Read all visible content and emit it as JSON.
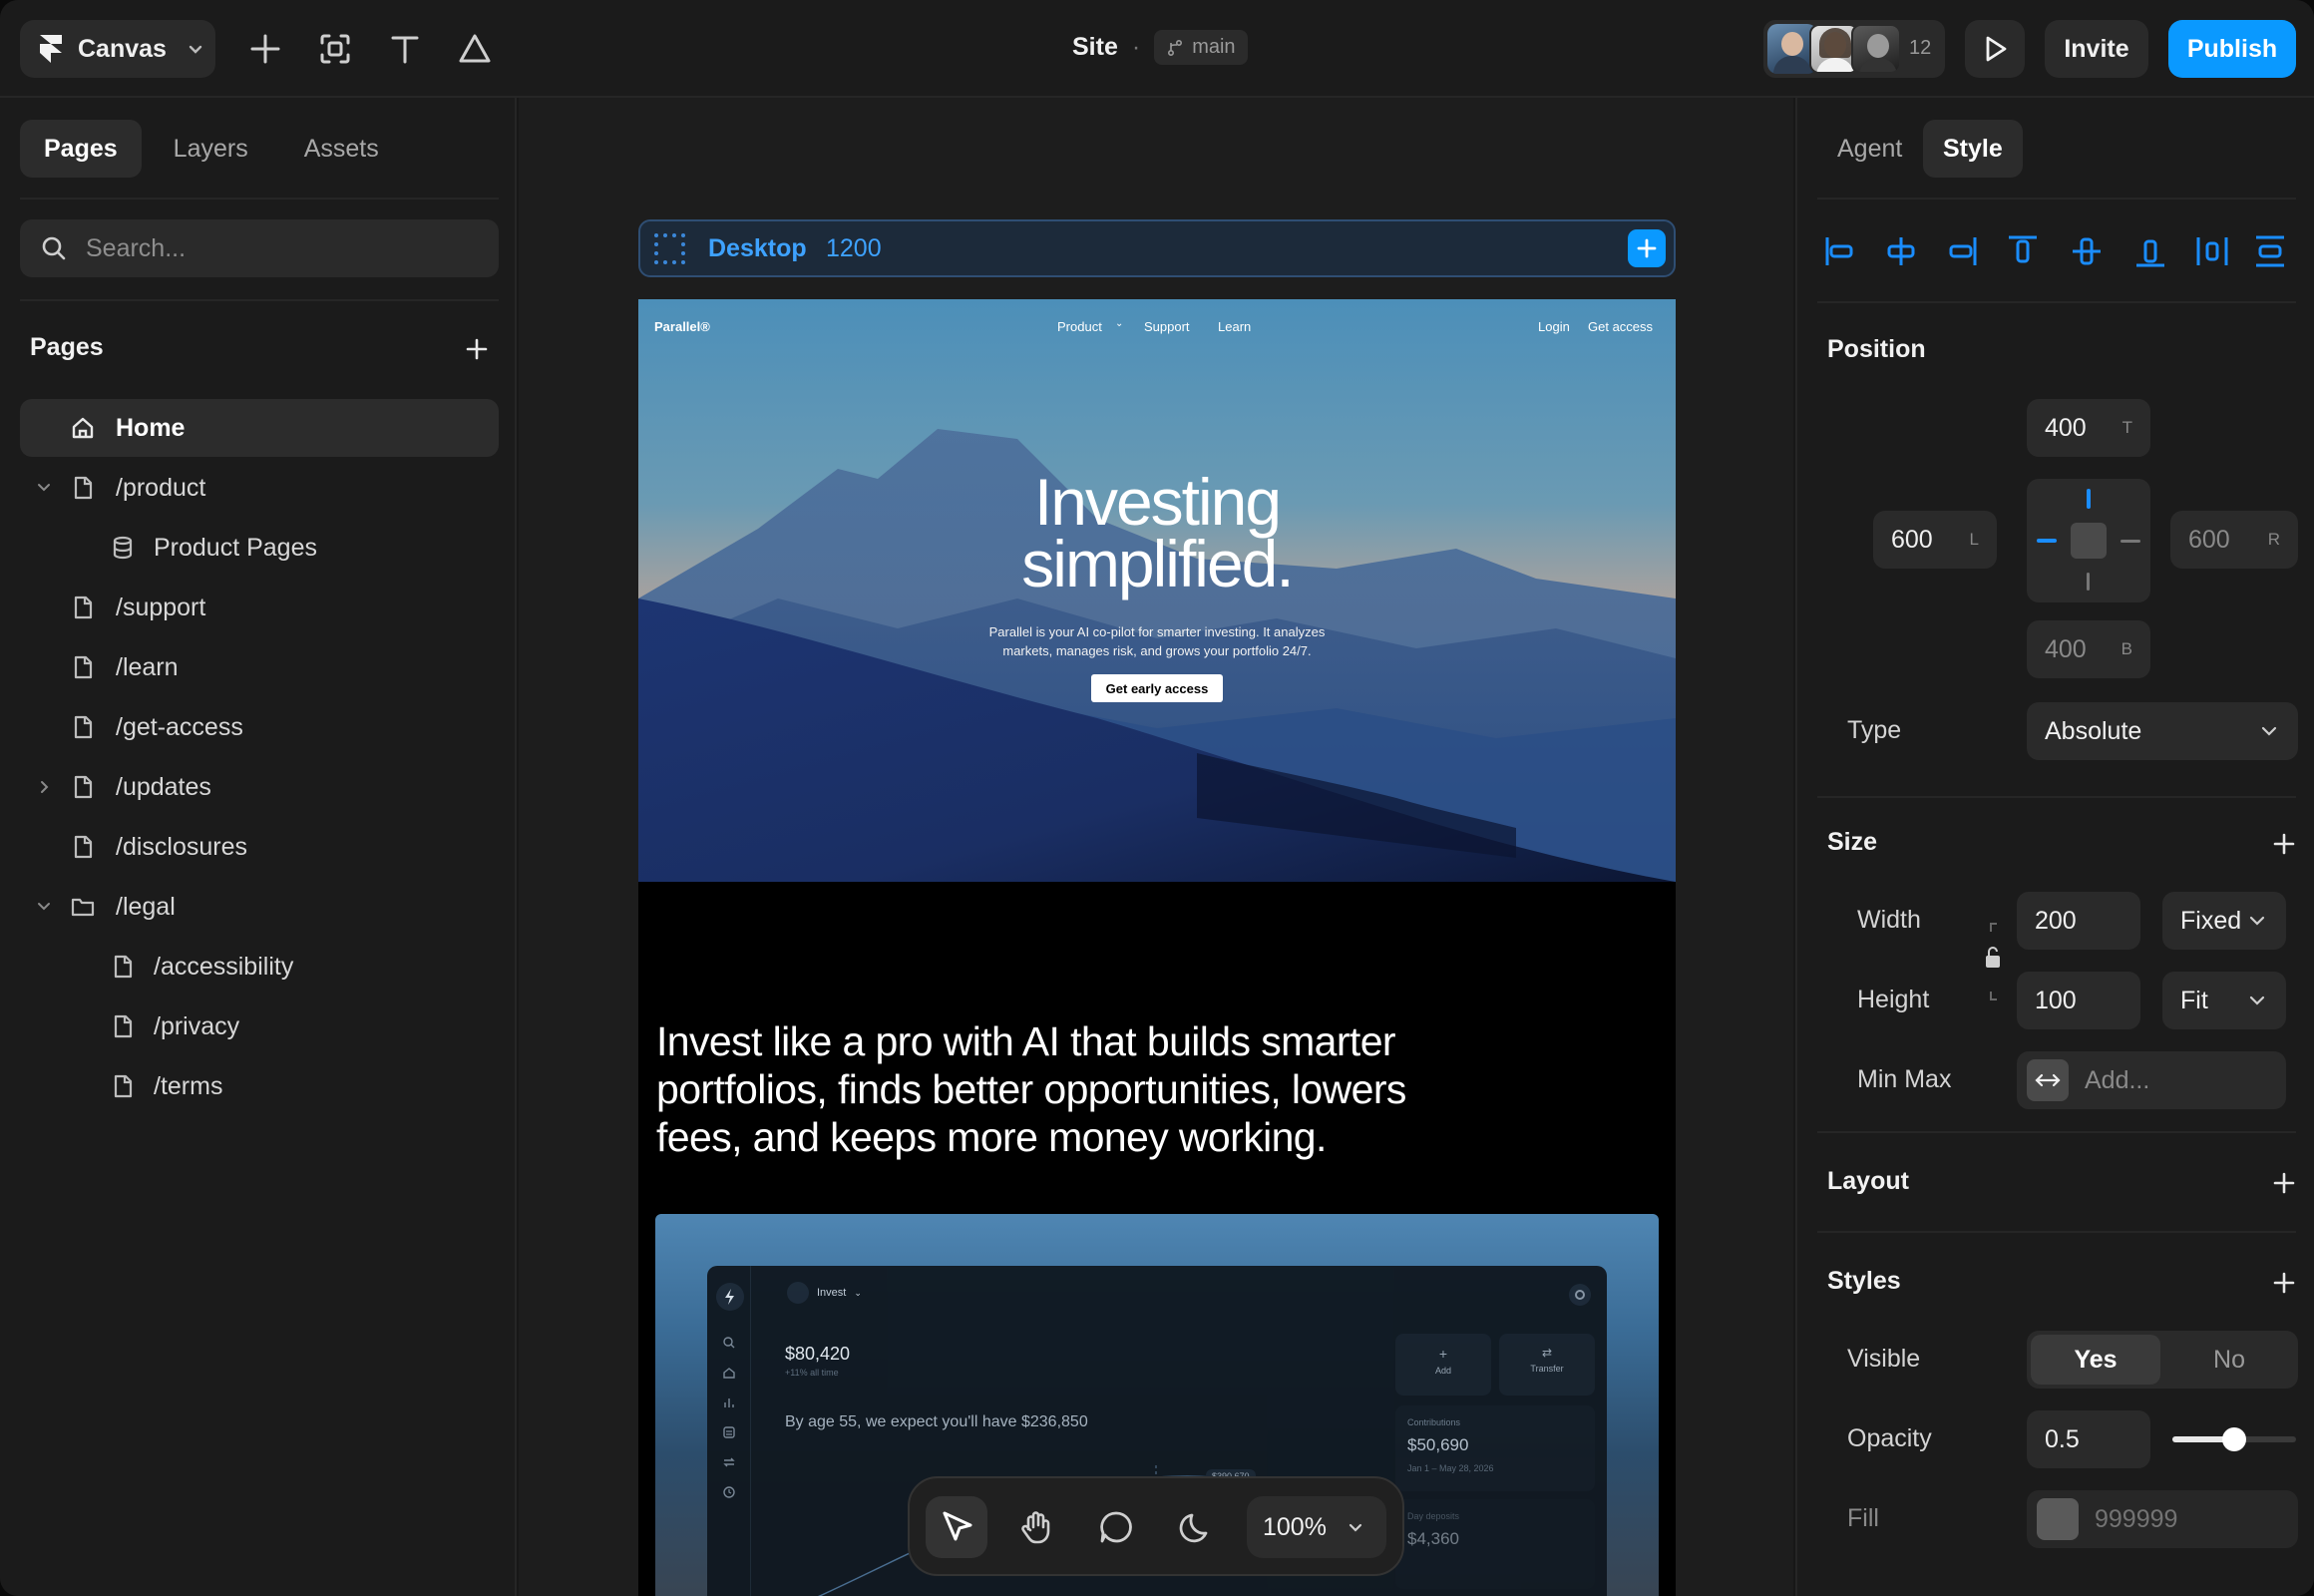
{
  "topbar": {
    "app_menu": "Canvas",
    "site_title": "Site",
    "branch": "main",
    "collaborator_count": "12",
    "invite_label": "Invite",
    "publish_label": "Publish",
    "accent": "#0a99ff"
  },
  "left": {
    "tabs": [
      "Pages",
      "Layers",
      "Assets"
    ],
    "search_placeholder": "Search...",
    "pages_title": "Pages",
    "items": [
      {
        "label": "Home"
      },
      {
        "label": "/product"
      },
      {
        "label": "Product Pages"
      },
      {
        "label": "/support"
      },
      {
        "label": "/learn"
      },
      {
        "label": "/get-access"
      },
      {
        "label": "/updates"
      },
      {
        "label": "/disclosures"
      },
      {
        "label": "/legal"
      },
      {
        "label": "/accessibility"
      },
      {
        "label": "/privacy"
      },
      {
        "label": "/terms"
      }
    ]
  },
  "canvas": {
    "breakpoint_name": "Desktop",
    "breakpoint_width": "1200",
    "site": {
      "brand": "Parallel®",
      "nav": [
        "Product",
        "Support",
        "Learn"
      ],
      "login": "Login",
      "get_access": "Get access",
      "hero_line1": "Investing",
      "hero_line2": "simplified.",
      "hero_sub1": "Parallel is your AI co-pilot for smarter investing. It analyzes",
      "hero_sub2": "markets, manages risk, and grows your portfolio 24/7.",
      "cta": "Get early access",
      "pitch1": "Invest like a pro with AI that builds smarter",
      "pitch2": "portfolios, finds better opportunities, lowers",
      "pitch3": "fees, and keeps more money working.",
      "dash": {
        "menu": "Invest",
        "balance": "$80,420",
        "balance_sub": "+11% all time",
        "forecast": "By age 55, we expect you'll have $236,850",
        "marker": "$390,670",
        "add": "Add",
        "transfer": "Transfer",
        "contrib_label": "Contributions",
        "contrib_value": "$50,690",
        "contrib_range": "Jan 1 – May 28, 2026",
        "deposits_label": "Day deposits",
        "deposits_value": "$4,360"
      }
    },
    "zoom": "100%"
  },
  "right": {
    "tabs": [
      "Agent",
      "Style"
    ],
    "position": {
      "title": "Position",
      "top": "400",
      "top_suffix": "T",
      "left": "600",
      "left_suffix": "L",
      "right": "600",
      "right_suffix": "R",
      "bottom": "400",
      "bottom_suffix": "B",
      "type_label": "Type",
      "type_value": "Absolute"
    },
    "size": {
      "title": "Size",
      "width_label": "Width",
      "width_value": "200",
      "width_mode": "Fixed",
      "height_label": "Height",
      "height_value": "100",
      "height_mode": "Fit",
      "minmax_label": "Min Max",
      "minmax_placeholder": "Add..."
    },
    "layout_title": "Layout",
    "styles": {
      "title": "Styles",
      "visible_label": "Visible",
      "yes": "Yes",
      "no": "No",
      "opacity_label": "Opacity",
      "opacity_value": "0.5",
      "opacity": 0.5,
      "fill_label": "Fill",
      "fill_value": "999999"
    }
  }
}
